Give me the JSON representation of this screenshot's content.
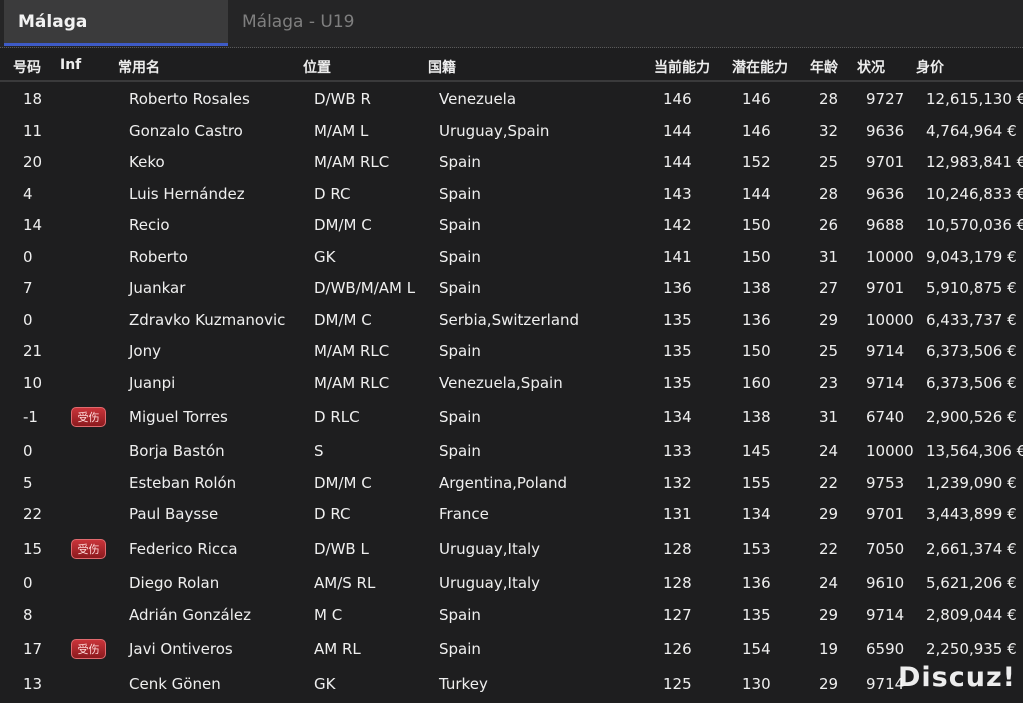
{
  "tabs": [
    {
      "label": "Málaga",
      "active": true
    },
    {
      "label": "Málaga - U19",
      "active": false
    }
  ],
  "columns": {
    "number": "号码",
    "inf": "Inf",
    "name": "常用名",
    "position": "位置",
    "nationality": "国籍",
    "current_ability": "当前能力",
    "potential_ability": "潜在能力",
    "age": "年龄",
    "condition": "状况",
    "value": "身价"
  },
  "injury_badge_label": "受伤",
  "players": [
    {
      "number": "18",
      "inf": "",
      "name": "Roberto Rosales",
      "position": "D/WB R",
      "nationality": "Venezuela",
      "ca": "146",
      "pa": "146",
      "age": "28",
      "condition": "9727",
      "value": "12,615,130 €"
    },
    {
      "number": "11",
      "inf": "",
      "name": "Gonzalo Castro",
      "position": "M/AM L",
      "nationality": "Uruguay,Spain",
      "ca": "144",
      "pa": "146",
      "age": "32",
      "condition": "9636",
      "value": "4,764,964 €"
    },
    {
      "number": "20",
      "inf": "",
      "name": "Keko",
      "position": "M/AM RLC",
      "nationality": "Spain",
      "ca": "144",
      "pa": "152",
      "age": "25",
      "condition": "9701",
      "value": "12,983,841 €"
    },
    {
      "number": "4",
      "inf": "",
      "name": "Luis Hernández",
      "position": "D RC",
      "nationality": "Spain",
      "ca": "143",
      "pa": "144",
      "age": "28",
      "condition": "9636",
      "value": "10,246,833 €"
    },
    {
      "number": "14",
      "inf": "",
      "name": "Recio",
      "position": "DM/M C",
      "nationality": "Spain",
      "ca": "142",
      "pa": "150",
      "age": "26",
      "condition": "9688",
      "value": "10,570,036 €"
    },
    {
      "number": "0",
      "inf": "",
      "name": "Roberto",
      "position": "GK",
      "nationality": "Spain",
      "ca": "141",
      "pa": "150",
      "age": "31",
      "condition": "10000",
      "value": "9,043,179 €"
    },
    {
      "number": "7",
      "inf": "",
      "name": "Juankar",
      "position": "D/WB/M/AM L",
      "nationality": "Spain",
      "ca": "136",
      "pa": "138",
      "age": "27",
      "condition": "9701",
      "value": "5,910,875 €"
    },
    {
      "number": "0",
      "inf": "",
      "name": "Zdravko Kuzmanovic",
      "position": "DM/M C",
      "nationality": "Serbia,Switzerland",
      "ca": "135",
      "pa": "136",
      "age": "29",
      "condition": "10000",
      "value": "6,433,737 €"
    },
    {
      "number": "21",
      "inf": "",
      "name": "Jony",
      "position": "M/AM RLC",
      "nationality": "Spain",
      "ca": "135",
      "pa": "150",
      "age": "25",
      "condition": "9714",
      "value": "6,373,506 €"
    },
    {
      "number": "10",
      "inf": "",
      "name": "Juanpi",
      "position": "M/AM RLC",
      "nationality": "Venezuela,Spain",
      "ca": "135",
      "pa": "160",
      "age": "23",
      "condition": "9714",
      "value": "6,373,506 €"
    },
    {
      "number": "-1",
      "inf": "受伤",
      "name": "Miguel Torres",
      "position": "D RLC",
      "nationality": "Spain",
      "ca": "134",
      "pa": "138",
      "age": "31",
      "condition": "6740",
      "value": "2,900,526 €"
    },
    {
      "number": "0",
      "inf": "",
      "name": "Borja Bastón",
      "position": "S",
      "nationality": "Spain",
      "ca": "133",
      "pa": "145",
      "age": "24",
      "condition": "10000",
      "value": "13,564,306 €"
    },
    {
      "number": "5",
      "inf": "",
      "name": "Esteban Rolón",
      "position": "DM/M C",
      "nationality": "Argentina,Poland",
      "ca": "132",
      "pa": "155",
      "age": "22",
      "condition": "9753",
      "value": "1,239,090 €"
    },
    {
      "number": "22",
      "inf": "",
      "name": "Paul Baysse",
      "position": "D RC",
      "nationality": "France",
      "ca": "131",
      "pa": "134",
      "age": "29",
      "condition": "9701",
      "value": "3,443,899 €"
    },
    {
      "number": "15",
      "inf": "受伤",
      "name": "Federico Ricca",
      "position": "D/WB L",
      "nationality": "Uruguay,Italy",
      "ca": "128",
      "pa": "153",
      "age": "22",
      "condition": "7050",
      "value": "2,661,374 €"
    },
    {
      "number": "0",
      "inf": "",
      "name": "Diego Rolan",
      "position": "AM/S RL",
      "nationality": "Uruguay,Italy",
      "ca": "128",
      "pa": "136",
      "age": "24",
      "condition": "9610",
      "value": "5,621,206 €"
    },
    {
      "number": "8",
      "inf": "",
      "name": "Adrián González",
      "position": "M C",
      "nationality": "Spain",
      "ca": "127",
      "pa": "135",
      "age": "29",
      "condition": "9714",
      "value": "2,809,044 €"
    },
    {
      "number": "17",
      "inf": "受伤",
      "name": "Javi Ontiveros",
      "position": "AM RL",
      "nationality": "Spain",
      "ca": "126",
      "pa": "154",
      "age": "19",
      "condition": "6590",
      "value": "2,250,935 €"
    },
    {
      "number": "13",
      "inf": "",
      "name": "Cenk Gönen",
      "position": "GK",
      "nationality": "Turkey",
      "ca": "125",
      "pa": "130",
      "age": "29",
      "condition": "9714",
      "value": ""
    }
  ],
  "watermark": "Discuz!"
}
